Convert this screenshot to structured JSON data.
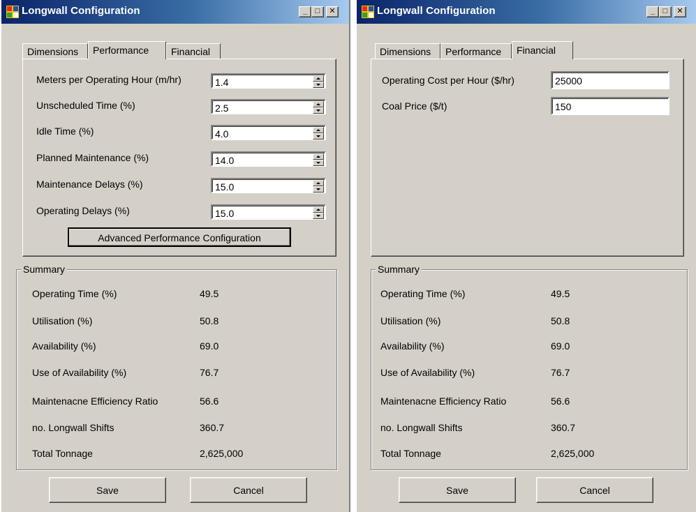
{
  "windows": [
    {
      "title": "Longwall Configuration",
      "tabs": [
        "Dimensions",
        "Performance",
        "Financial"
      ],
      "active_tab": "Performance",
      "fields": [
        {
          "label": "Meters per Operating Hour (m/hr)",
          "value": "1.4"
        },
        {
          "label": "Unscheduled Time (%)",
          "value": "2.5"
        },
        {
          "label": "Idle Time (%)",
          "value": "4.0"
        },
        {
          "label": "Planned Maintenance (%)",
          "value": "14.0"
        },
        {
          "label": "Maintenance Delays (%)",
          "value": "15.0"
        },
        {
          "label": "Operating Delays (%)",
          "value": "15.0"
        }
      ],
      "advanced_button": "Advanced Performance Configuration",
      "summary": {
        "title": "Summary",
        "rows": [
          {
            "label": "Operating Time (%)",
            "value": "49.5"
          },
          {
            "label": "Utilisation (%)",
            "value": "50.8"
          },
          {
            "label": "Availability (%)",
            "value": "69.0"
          },
          {
            "label": "Use of Availability (%)",
            "value": "76.7"
          },
          {
            "label": "Maintenacne Efficiency Ratio",
            "value": "56.6"
          },
          {
            "label": "no. Longwall Shifts",
            "value": "360.7"
          },
          {
            "label": "Total Tonnage",
            "value": "2,625,000"
          }
        ]
      },
      "save_label": "Save",
      "cancel_label": "Cancel"
    },
    {
      "title": "Longwall Configuration",
      "tabs": [
        "Dimensions",
        "Performance",
        "Financial"
      ],
      "active_tab": "Financial",
      "fields": [
        {
          "label": "Operating Cost per Hour ($/hr)",
          "value": "25000"
        },
        {
          "label": "Coal Price ($/t)",
          "value": "150"
        }
      ],
      "summary": {
        "title": "Summary",
        "rows": [
          {
            "label": "Operating Time (%)",
            "value": "49.5"
          },
          {
            "label": "Utilisation (%)",
            "value": "50.8"
          },
          {
            "label": "Availability (%)",
            "value": "69.0"
          },
          {
            "label": "Use of Availability (%)",
            "value": "76.7"
          },
          {
            "label": "Maintenacne Efficiency Ratio",
            "value": "56.6"
          },
          {
            "label": "no. Longwall Shifts",
            "value": "360.7"
          },
          {
            "label": "Total Tonnage",
            "value": "2,625,000"
          }
        ]
      },
      "save_label": "Save",
      "cancel_label": "Cancel"
    }
  ],
  "icons": {
    "app": "longwall-app-icon",
    "minimize": "minimize-icon",
    "maximize": "maximize-icon",
    "close": "close-icon",
    "spin_up": "spin-up-arrow-icon",
    "spin_down": "spin-down-arrow-icon"
  },
  "colors": {
    "face": "#d4d0c8",
    "titlebar_start": "#0a246a",
    "titlebar_end": "#a6caf0",
    "field_bg": "#ffffff"
  }
}
